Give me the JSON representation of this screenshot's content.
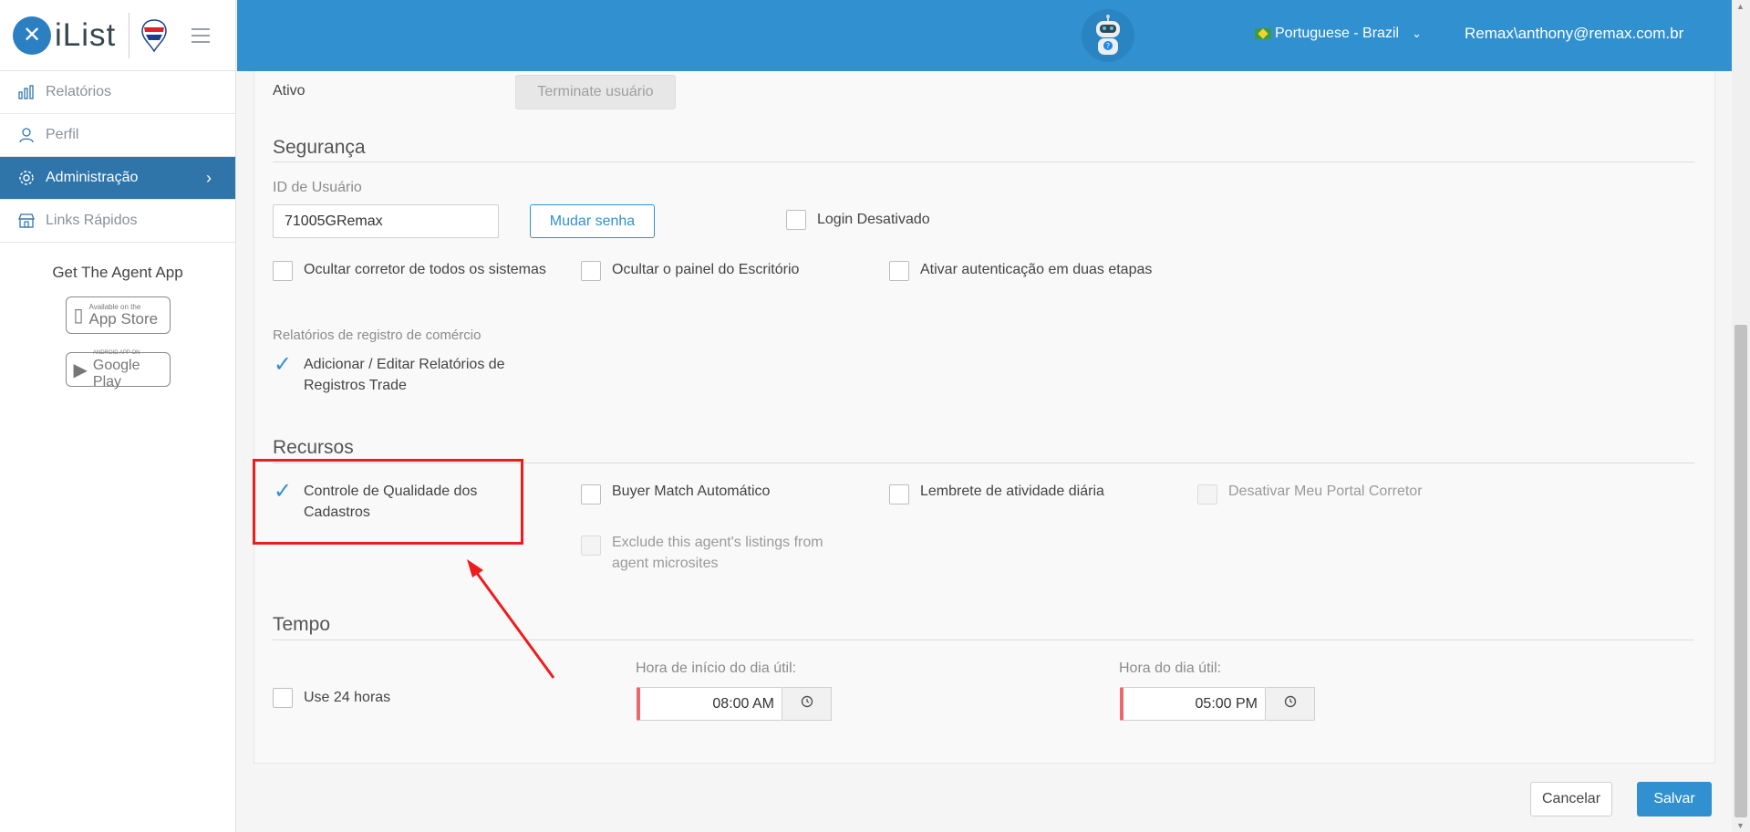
{
  "sidebar": {
    "logo_text": "iList",
    "items": [
      {
        "label": "Relatórios",
        "icon": "bar-chart-icon"
      },
      {
        "label": "Perfil",
        "icon": "user-icon"
      },
      {
        "label": "Administração",
        "icon": "gear-icon"
      },
      {
        "label": "Links Rápidos",
        "icon": "store-icon"
      }
    ],
    "agent_app_label": "Get The Agent App",
    "app_store": {
      "small": "Available on the",
      "big": "App Store"
    },
    "google_play": {
      "small": "ANDROID APP ON",
      "big": "Google Play"
    }
  },
  "header": {
    "language": "Portuguese - Brazil",
    "user": "Remax\\anthony@remax.com.br",
    "accent_color": "#3191d0"
  },
  "form": {
    "ativo_label": "Ativo",
    "terminate_label": "Terminate usuário",
    "seguranca_title": "Segurança",
    "user_id_label": "ID de Usuário",
    "user_id_value": "71005GRemax",
    "change_password_label": "Mudar senha",
    "login_disabled_label": "Login Desativado",
    "hide_broker_label": "Ocultar corretor de todos os sistemas",
    "hide_office_panel_label": "Ocultar o painel do Escritório",
    "two_factor_label": "Ativar autenticação em duas etapas",
    "trade_reports_label": "Relatórios de registro de comércio",
    "trade_reports_option": "Adicionar / Editar Relatórios de Registros Trade",
    "recursos_title": "Recursos",
    "quality_control_label": "Controle de Qualidade dos Cadastros",
    "buyer_match_label": "Buyer Match Automático",
    "daily_reminder_label": "Lembrete de atividade diária",
    "disable_portal_label": "Desativar Meu Portal Corretor",
    "exclude_listings_label": "Exclude this agent's listings from agent microsites",
    "tempo_title": "Tempo",
    "use_24h_label": "Use 24 horas",
    "start_time_label": "Hora de início do dia útil:",
    "start_time_value": "08:00 AM",
    "end_time_label": "Hora do dia útil:",
    "end_time_value": "05:00 PM"
  },
  "footer": {
    "cancel_label": "Cancelar",
    "save_label": "Salvar"
  }
}
